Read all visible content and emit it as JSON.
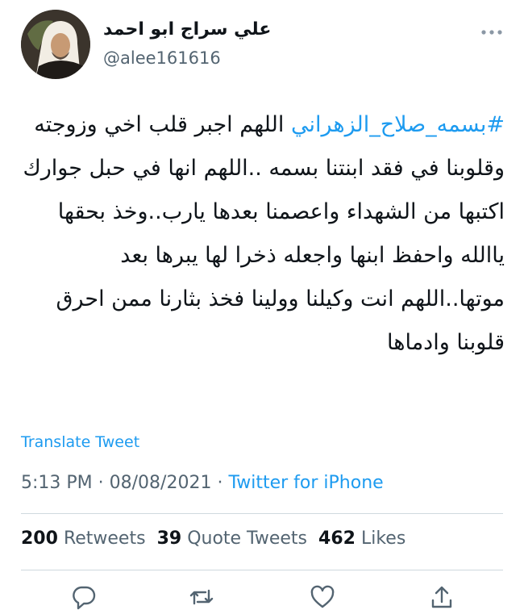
{
  "tweet": {
    "author": {
      "display_name": "علي سراج  ابو احمد",
      "handle": "@alee161616"
    },
    "text": {
      "hashtag": "#بسمه_صلاح_الزهراني",
      "body": " اللهم اجبر قلب اخي وزوجته وقلوبنا في فقد ابنتنا بسمه ..اللهم انها في حبل جوارك اكتبها من الشهداء واعصمنا بعدها يارب..وخذ بحقها ياالله واحفظ ابنها واجعله ذخرا لها يبرها بعد موتها..اللهم انت وكيلنا وولينا فخذ بثارنا ممن احرق قلوبنا وادماها"
    },
    "translate_label": "Translate Tweet",
    "time": "5:13 PM",
    "separator": " · ",
    "date": "08/08/2021",
    "source": "Twitter for iPhone",
    "stats": {
      "retweets_count": "200",
      "retweets_label": "Retweets",
      "quotes_count": "39",
      "quotes_label": "Quote Tweets",
      "likes_count": "462",
      "likes_label": "Likes"
    }
  },
  "icons": {
    "more": "more-horizontal-icon",
    "reply": "reply-icon",
    "retweet": "retweet-icon",
    "like": "heart-icon",
    "share": "share-icon"
  },
  "colors": {
    "accent": "#1d9bf0",
    "text": "#0f1419",
    "secondary": "#536471",
    "divider": "#cfd9de"
  }
}
